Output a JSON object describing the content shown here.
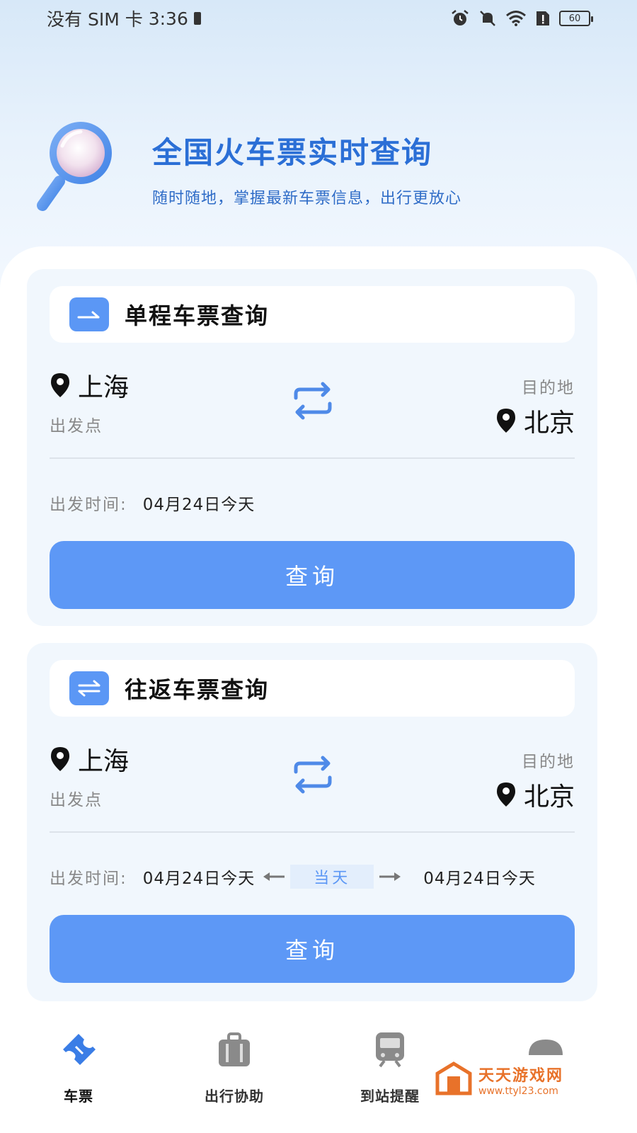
{
  "status_bar": {
    "carrier": "没有 SIM 卡",
    "time": "3:36",
    "battery": "60"
  },
  "header": {
    "title": "全国火车票实时查询",
    "subtitle": "随时随地，掌握最新车票信息，出行更放心"
  },
  "one_way": {
    "title": "单程车票查询",
    "from_city": "上海",
    "from_label": "出发点",
    "to_label": "目的地",
    "to_city": "北京",
    "time_label": "出发时间:",
    "date": "04月24日今天",
    "button": "查询"
  },
  "round_trip": {
    "title": "往返车票查询",
    "from_city": "上海",
    "from_label": "出发点",
    "to_label": "目的地",
    "to_city": "北京",
    "time_label": "出发时间:",
    "depart_date": "04月24日今天",
    "same_day": "当天",
    "return_date": "04月24日今天",
    "button": "查询"
  },
  "bottom_nav": {
    "items": [
      {
        "label": "车票",
        "icon": "ticket-icon",
        "active": true
      },
      {
        "label": "出行协助",
        "icon": "luggage-icon",
        "active": false
      },
      {
        "label": "到站提醒",
        "icon": "train-icon",
        "active": false
      },
      {
        "label": "",
        "icon": "profile-icon",
        "active": false
      }
    ]
  },
  "watermark": {
    "title": "天天游戏网",
    "url": "www.ttyl23.com"
  },
  "colors": {
    "accent": "#5d98f6",
    "title_blue": "#2b6fd6",
    "card_bg": "#f1f7fd"
  }
}
